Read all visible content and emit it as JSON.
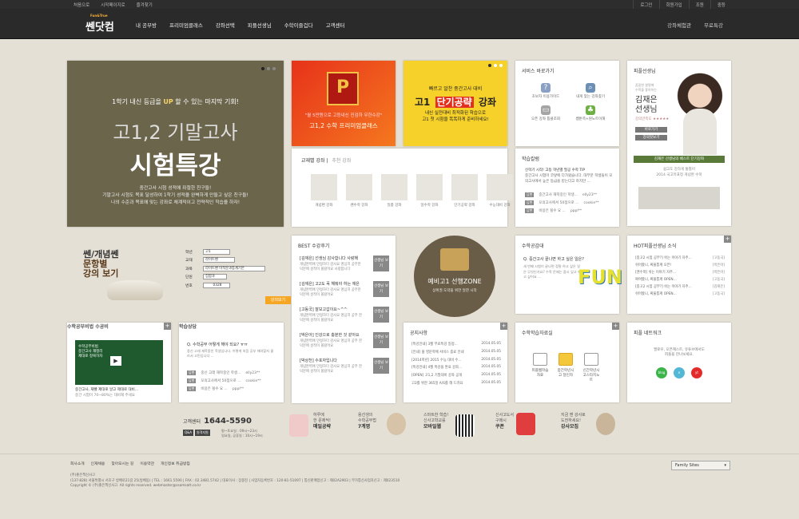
{
  "topbar": {
    "left": [
      "처음으로",
      "시작페이지로",
      "즐겨찾기"
    ],
    "right": [
      "로그인",
      "회원가입",
      "조원",
      "중등"
    ]
  },
  "nav": {
    "logo": "쎈닷컴",
    "logo_sub": "Fun&True",
    "menu": [
      "내 공부방",
      "프리미엄클래스",
      "강좌선택",
      "피플선생님",
      "수학이즐겁다",
      "고객센터"
    ],
    "right": [
      "강좌체험관",
      "무료특강"
    ]
  },
  "hero": {
    "line1_pre": "1학기 내신 등급을 ",
    "line1_em": "UP",
    "line1_post": " 할 수 있는 마지막 기회!",
    "line2": "고1,2 기말고사",
    "line3": "시험특강",
    "desc": [
      "중간고사 시험 성적에 좌절한 친구들!",
      "기말고사 시험도 목표 달성하여 1학기 성적을 완벽하게 만들고 싶은 친구들!",
      "나의 수준과 목표에 맞는 강좌로 체계적이고 전략적인 학습을 하자!"
    ]
  },
  "promo1": {
    "badge": "P",
    "l1": "\"월 5만원으로 고등내신 진검하 무한수강\"",
    "l2": "고1,2 수학 프리미엄클래스"
  },
  "promo2": {
    "l1": "빠르고 알찬   중간고사 대비",
    "l2_pre": "고1 ",
    "l2_em": "단기공략",
    "l2_post": " 강좌",
    "l3": [
      "내신 실전대비 최적화된 학습으로",
      "고1 첫 시험을 똑똑하게 준비하세요!"
    ]
  },
  "service": {
    "title": "서비스 바로가기",
    "items": [
      {
        "label": "초보자 이용가이드",
        "icon": "guide-icon",
        "color": "#8aa0c4"
      },
      {
        "label": "내게 맞는 강좌찾기",
        "icon": "search-icon",
        "color": "#6b8fb5"
      },
      {
        "label": "오픈 강좌 톱클조회",
        "icon": "monitor-icon",
        "color": "#a5a5a5"
      },
      {
        "label": "쌤툰쪽+원노트이해",
        "icon": "clover-icon",
        "color": "#6db043"
      }
    ]
  },
  "teacher": {
    "title": "피플선생님",
    "small": [
      "꼼꼼한 설명에",
      "수학을 좋아하는"
    ],
    "name": [
      "김재은",
      "선생님"
    ],
    "tag": "강의만족도 ★★★★★",
    "btn1": "바로가기",
    "btn2": "강의맛보기",
    "bar": "김재은 선생님의 베스트 단기강좌",
    "cap": [
      "쉽고도 강하게 통틀어",
      "2014 국고목표정 개념완 수학"
    ]
  },
  "subject": {
    "tab1": "교재별 강좌",
    "tab2": "추천 강좌",
    "items": [
      "개념편 강좌",
      "쎈수학 강좌",
      "일품 강좌",
      "일수학 강좌",
      "단기공략 강좌",
      "수능대비 강좌"
    ]
  },
  "study": {
    "title": "학습칼럼",
    "headline": "신학기 시작! 고등 학년별 필공 수학 TIP",
    "desc": [
      "중간고사 시험이 코앞에 다가왔습니다. 대부분 학생들이 모의고사에서 높은 등급을 받는다고 하지만 ..."
    ],
    "rows": [
      {
        "tag": "답변",
        "text": "중간고사 재학중인 학생...",
        "user": "elly23**"
      },
      {
        "tag": "답변",
        "text": "모의고사에서 50점으로 ...",
        "user": "cookie**"
      },
      {
        "tag": "답변",
        "text": "비용은 될수 요 ...",
        "user": "pppl**"
      }
    ]
  },
  "finder": {
    "title1": "쎈/개념쎈",
    "title2": "문항별",
    "title3": "강의 보기",
    "rows": [
      {
        "label": "학년",
        "value": "고1"
      },
      {
        "label": "교재",
        "value": "라이트쎈"
      },
      {
        "label": "과목",
        "value": "라이트쎈 미적분과통계기본"
      },
      {
        "label": "단원",
        "value": "집합과"
      },
      {
        "label": "번호",
        "value": "0328"
      }
    ],
    "go": "강의보기"
  },
  "best": {
    "title": "BEST 수강후기",
    "items": [
      {
        "q": "[김재은] 선생님 감사합니다 사랑해",
        "d": "개념완벽에 만정하다 감사요 명심히 공부한 덕분에 성적이 올랐어요 사랑합니다",
        "b": "선생님 보기"
      },
      {
        "q": "[김재은] 고2도 꼭 해줘야 하는 재은",
        "d": "개념완벽에 만정하다 감사요 명심히 공부한 덕분에 성적이 올랐어요",
        "b": "선생님 보기"
      },
      {
        "q": "[고동국] 잘보고갑이요~^^",
        "d": "개념완벽에 만정하다 감사요 명심히 공부 한 덕분에 성적이 올랐어요",
        "b": "선생님 보기"
      },
      {
        "q": "[박은아] 인강으로 충분한 것 같아요",
        "d": "개념완벽에 만정하다 감사요 명심히 공부 한 덕분에 성적이 올랐어요",
        "b": "선생님 보기"
      },
      {
        "q": "[박상천] 수포자입니다",
        "d": "개념완벽에 만정하다 감사요 명심히 공부 한 덕분에 성적이 올랐어요",
        "b": "선생님 보기"
      }
    ]
  },
  "zone": {
    "l1": "예비고1 선행ZONE",
    "l2": "상위권 도약을 위한 알찬 시작"
  },
  "mathstory": {
    "title": "수학공감대",
    "q": "Q. 중간고사 끝나면 하고 싶은 일은?",
    "a": [
      "세 번째 시험이 끝나면 정말 하고 싶은 일은 무엇인가요? 수학 문제는 잠시 잊고 쉬고 싶어요 ..."
    ],
    "fun": "FUN"
  },
  "hot": {
    "title": "HOT피플선생님 소식",
    "items": [
      {
        "t": "[중고2 시험 공부?] 쉬는 이야기 자주...",
        "w": "[고동국]"
      },
      {
        "t": "쉬어봤니, 짜물통계 오픈!",
        "w": "[박은아]"
      },
      {
        "t": "[엔수학] 쉬는 이야기 자주...",
        "w": "[박은아]"
      },
      {
        "t": "짜여봤니, 짜물통계 OPEN...",
        "w": "[고동국]"
      },
      {
        "t": "[중고2 시험 공부?] 쉬는 이야기 자주...",
        "w": "[김재은]"
      },
      {
        "t": "쉬어봤니, 짜물통계 OPEN...",
        "w": "[고동국]"
      }
    ]
  },
  "curriculum": {
    "title": "수학공부비법 수공비",
    "video": [
      "수학공부비법",
      "중간고사 재정리",
      "제대로 정복하자"
    ],
    "play": "▶",
    "cap1": "중간고사, 재빨 제대로 알고 제대로 대비...",
    "cap2": "중간 시험이 70~80%는 대비해 주세요"
  },
  "consult": {
    "title": "학습상담",
    "q": "Q. 수학공부 어떻게 해야 되요? ㅠㅠ",
    "t": [
      "중신 고래 재학중인 학생입니다. 어떻게 처음 공부 해야할지 몰라서 고민입니다 ..."
    ],
    "rows": [
      {
        "tag": "답변",
        "text": "중신 고래 재학중인 학생...",
        "user": "elly23**"
      },
      {
        "tag": "답변",
        "text": "모의고사에서 50점으로 ...",
        "user": "cookie**"
      },
      {
        "tag": "답변",
        "text": "비용은 될수 요 ...",
        "user": "pppl**"
      }
    ]
  },
  "notice": {
    "title": "공지사항",
    "items": [
      {
        "t": "[특강안내] 3월 무료특강 일정...",
        "d": "2014.05.05"
      },
      {
        "t": "[안내] 홈 영문학에 서비스 종료 안내",
        "d": "2014.05.05"
      },
      {
        "t": "[2014학년] 2015 수능 대비 수...",
        "d": "2014.05.05"
      },
      {
        "t": "[특강안내] 4월 특강을 완료 강좌...",
        "d": "2014.05.05"
      },
      {
        "t": "[OPEN] 고1,2 기말대비 강좌 공개",
        "d": "2014.05.05"
      },
      {
        "t": "고2를 위한 365일 A/S를 해 드려요",
        "d": "2014.05.05"
      }
    ]
  },
  "resources": {
    "title": "수학학습자료실",
    "items": [
      "피플쌤학습자료",
      "중간학년시고 달인자",
      "신간학년시고스타치노트"
    ]
  },
  "network": {
    "title": "피플 네트워크",
    "text": [
      "팔로우, 오픈캐스트, 유튜브에서도",
      "피플을 만나보세요."
    ],
    "icons": [
      {
        "name": "blog",
        "color": "#3bb54a"
      },
      {
        "name": "o",
        "color": "#53b8d6"
      },
      {
        "name": "yt",
        "color": "#e42b2b"
      }
    ]
  },
  "cs": {
    "label": "고객센터",
    "phone": "1644-5590",
    "tags": [
      "Q&A",
      "원격지원"
    ],
    "hours": [
      "평~토요일 : 09시~23시",
      "일요일, 공휴일 : 10시~19시"
    ]
  },
  "banners": [
    {
      "l1": "하루에",
      "l2": "한 문제씩!",
      "l3": "매일공략"
    },
    {
      "l1": "용선생의",
      "l2": "수학공부법",
      "l3": "7계명"
    },
    {
      "l1": "스마트한 학습!",
      "l2": "신사고학교를",
      "l3": "모바일웹"
    },
    {
      "l1": "신사고도서",
      "l2": "구매시",
      "l3": "쿠폰"
    },
    {
      "l1": "지금 쎈 강사로",
      "l2": "도전하세요!",
      "l3": "강사모집"
    }
  ],
  "footer": {
    "links": [
      "회사소개",
      "인재채용",
      "찾아오시는 길",
      "이용약관",
      "개인정보 취급방침"
    ],
    "company": [
      "(주)좋은책신사고",
      "(137-828) 서울특별시 서초구 방배로21길 25(방배동) | TEL : 1661.5590 | FAX : 02.3481.5742 | 대표이사 : 장봉진 | 사업자등록번호 : 120-81-51097 | 통신판매업신고 : 제02A2903 | 부가통신사업자신고 : 제023510",
      "Copyright © (주)좋은책신사고. All rights reserved. webmaster@ssamsatt.co.kr"
    ],
    "family": "Family Sites"
  }
}
